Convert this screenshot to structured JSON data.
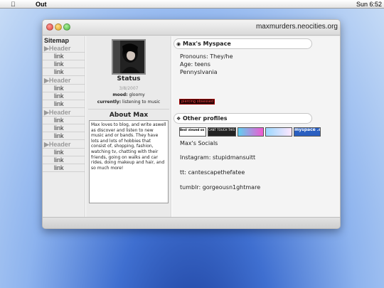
{
  "menubar": {
    "apple_icon": "apple-logo",
    "app_name": "Out",
    "clock": "Sun 6:52"
  },
  "window": {
    "title": "maxmurders.neocities.org"
  },
  "sitemap": {
    "title": "Sitemap",
    "sections": [
      {
        "header": "Header",
        "links": [
          "link",
          "link",
          "link"
        ]
      },
      {
        "header": "Header",
        "links": [
          "link",
          "link",
          "link"
        ]
      },
      {
        "header": "Header",
        "links": [
          "link",
          "link",
          "link"
        ]
      },
      {
        "header": "Header",
        "links": [
          "link",
          "link",
          "link"
        ]
      }
    ]
  },
  "profile": {
    "status_title": "Status",
    "status_date": "3/8/2007",
    "mood_label": "mood:",
    "mood_value": "gloomy",
    "currently_label": "currently:",
    "currently_value": "listening to music",
    "about_title": "About Max",
    "about_text": "Max loves to blog, and write aswell as discover and listen to new music and or bands. They have lots and lots of hobbies that consist of, shopping, fashion, watching tv, chatting with their friends, going on walks and car rides, doing makeup and hair, and so much more!"
  },
  "main": {
    "myspace_title": "Max's Myspace",
    "pronouns": "Pronouns: They/he",
    "age": "Age: teens",
    "location": "Pennyslvania",
    "piercing_badge": "piercing obsessed",
    "other_title": "Other profiles",
    "buttons": [
      "Best viewed on desktop",
      "CANT TOUCH THIS CANT TOUCH THAT",
      "",
      "",
      "myspace .com"
    ],
    "socials_title": "Max's Socials",
    "instagram": "Instagram: stupidmansuitt",
    "tt": "tt: cantescapethefatee",
    "tumblr": "tumblr: gorgeousn1ghtmare"
  }
}
